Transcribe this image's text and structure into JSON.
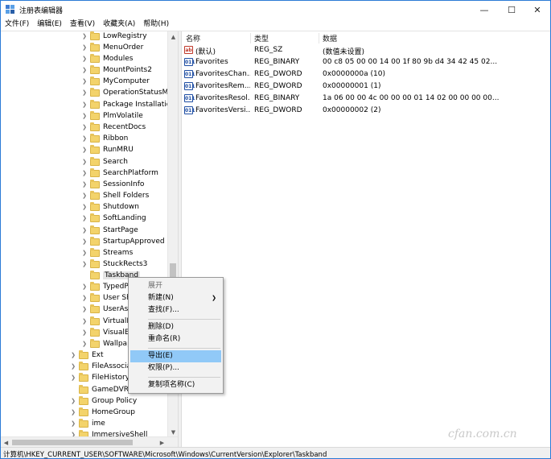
{
  "window": {
    "title": "注册表编辑器",
    "minimize": "—",
    "maximize": "☐",
    "close": "✕"
  },
  "menu": [
    "文件(F)",
    "编辑(E)",
    "查看(V)",
    "收藏夹(A)",
    "帮助(H)"
  ],
  "tree": {
    "items": [
      {
        "label": "LowRegistry"
      },
      {
        "label": "MenuOrder"
      },
      {
        "label": "Modules"
      },
      {
        "label": "MountPoints2"
      },
      {
        "label": "MyComputer"
      },
      {
        "label": "OperationStatusMa"
      },
      {
        "label": "Package Installation"
      },
      {
        "label": "PlmVolatile"
      },
      {
        "label": "RecentDocs"
      },
      {
        "label": "Ribbon"
      },
      {
        "label": "RunMRU"
      },
      {
        "label": "Search"
      },
      {
        "label": "SearchPlatform"
      },
      {
        "label": "SessionInfo"
      },
      {
        "label": "Shell Folders"
      },
      {
        "label": "Shutdown"
      },
      {
        "label": "SoftLanding"
      },
      {
        "label": "StartPage"
      },
      {
        "label": "StartupApproved"
      },
      {
        "label": "Streams"
      },
      {
        "label": "StuckRects3"
      },
      {
        "label": "Taskband"
      },
      {
        "label": "TypedPa"
      },
      {
        "label": "User Sh"
      },
      {
        "label": "UserAss"
      },
      {
        "label": "VirtualD"
      },
      {
        "label": "VisualEf"
      },
      {
        "label": "Wallpap"
      },
      {
        "label": "Ext"
      },
      {
        "label": "FileAssociati"
      },
      {
        "label": "FileHistory"
      },
      {
        "label": "GameDVR"
      },
      {
        "label": "Group Policy"
      },
      {
        "label": "HomeGroup"
      },
      {
        "label": "ime"
      },
      {
        "label": "ImmersiveShell"
      }
    ]
  },
  "columns": {
    "name": "名称",
    "type": "类型",
    "data": "数据"
  },
  "values": [
    {
      "icon": "ab",
      "name": "(默认)",
      "type": "REG_SZ",
      "data": "(数值未设置)"
    },
    {
      "icon": "bin",
      "name": "Favorites",
      "type": "REG_BINARY",
      "data": "00 c8 05 00 00 14 00 1f 80 9b d4 34 42 45 02..."
    },
    {
      "icon": "bin",
      "name": "FavoritesChan...",
      "type": "REG_DWORD",
      "data": "0x0000000a (10)"
    },
    {
      "icon": "bin",
      "name": "FavoritesRem...",
      "type": "REG_DWORD",
      "data": "0x00000001 (1)"
    },
    {
      "icon": "bin",
      "name": "FavoritesResol...",
      "type": "REG_BINARY",
      "data": "1a 06 00 00 4c 00 00 00 01 14 02 00 00 00 00..."
    },
    {
      "icon": "bin",
      "name": "FavoritesVersi...",
      "type": "REG_DWORD",
      "data": "0x00000002 (2)"
    }
  ],
  "context_menu": {
    "items": [
      {
        "label": "展开",
        "disabled": true
      },
      {
        "label": "新建(N)",
        "submenu": true
      },
      {
        "label": "查找(F)..."
      },
      {
        "label": "删除(D)"
      },
      {
        "label": "重命名(R)"
      },
      {
        "label": "导出(E)",
        "active": true
      },
      {
        "label": "权限(P)..."
      },
      {
        "label": "复制项名称(C)"
      }
    ]
  },
  "status": "计算机\\HKEY_CURRENT_USER\\SOFTWARE\\Microsoft\\Windows\\CurrentVersion\\Explorer\\Taskband",
  "watermark": "cfan.com.cn",
  "colors": {
    "accent": "#2b7bd6",
    "menu_highlight": "#91c9f7",
    "folder": "#f3d36b"
  }
}
